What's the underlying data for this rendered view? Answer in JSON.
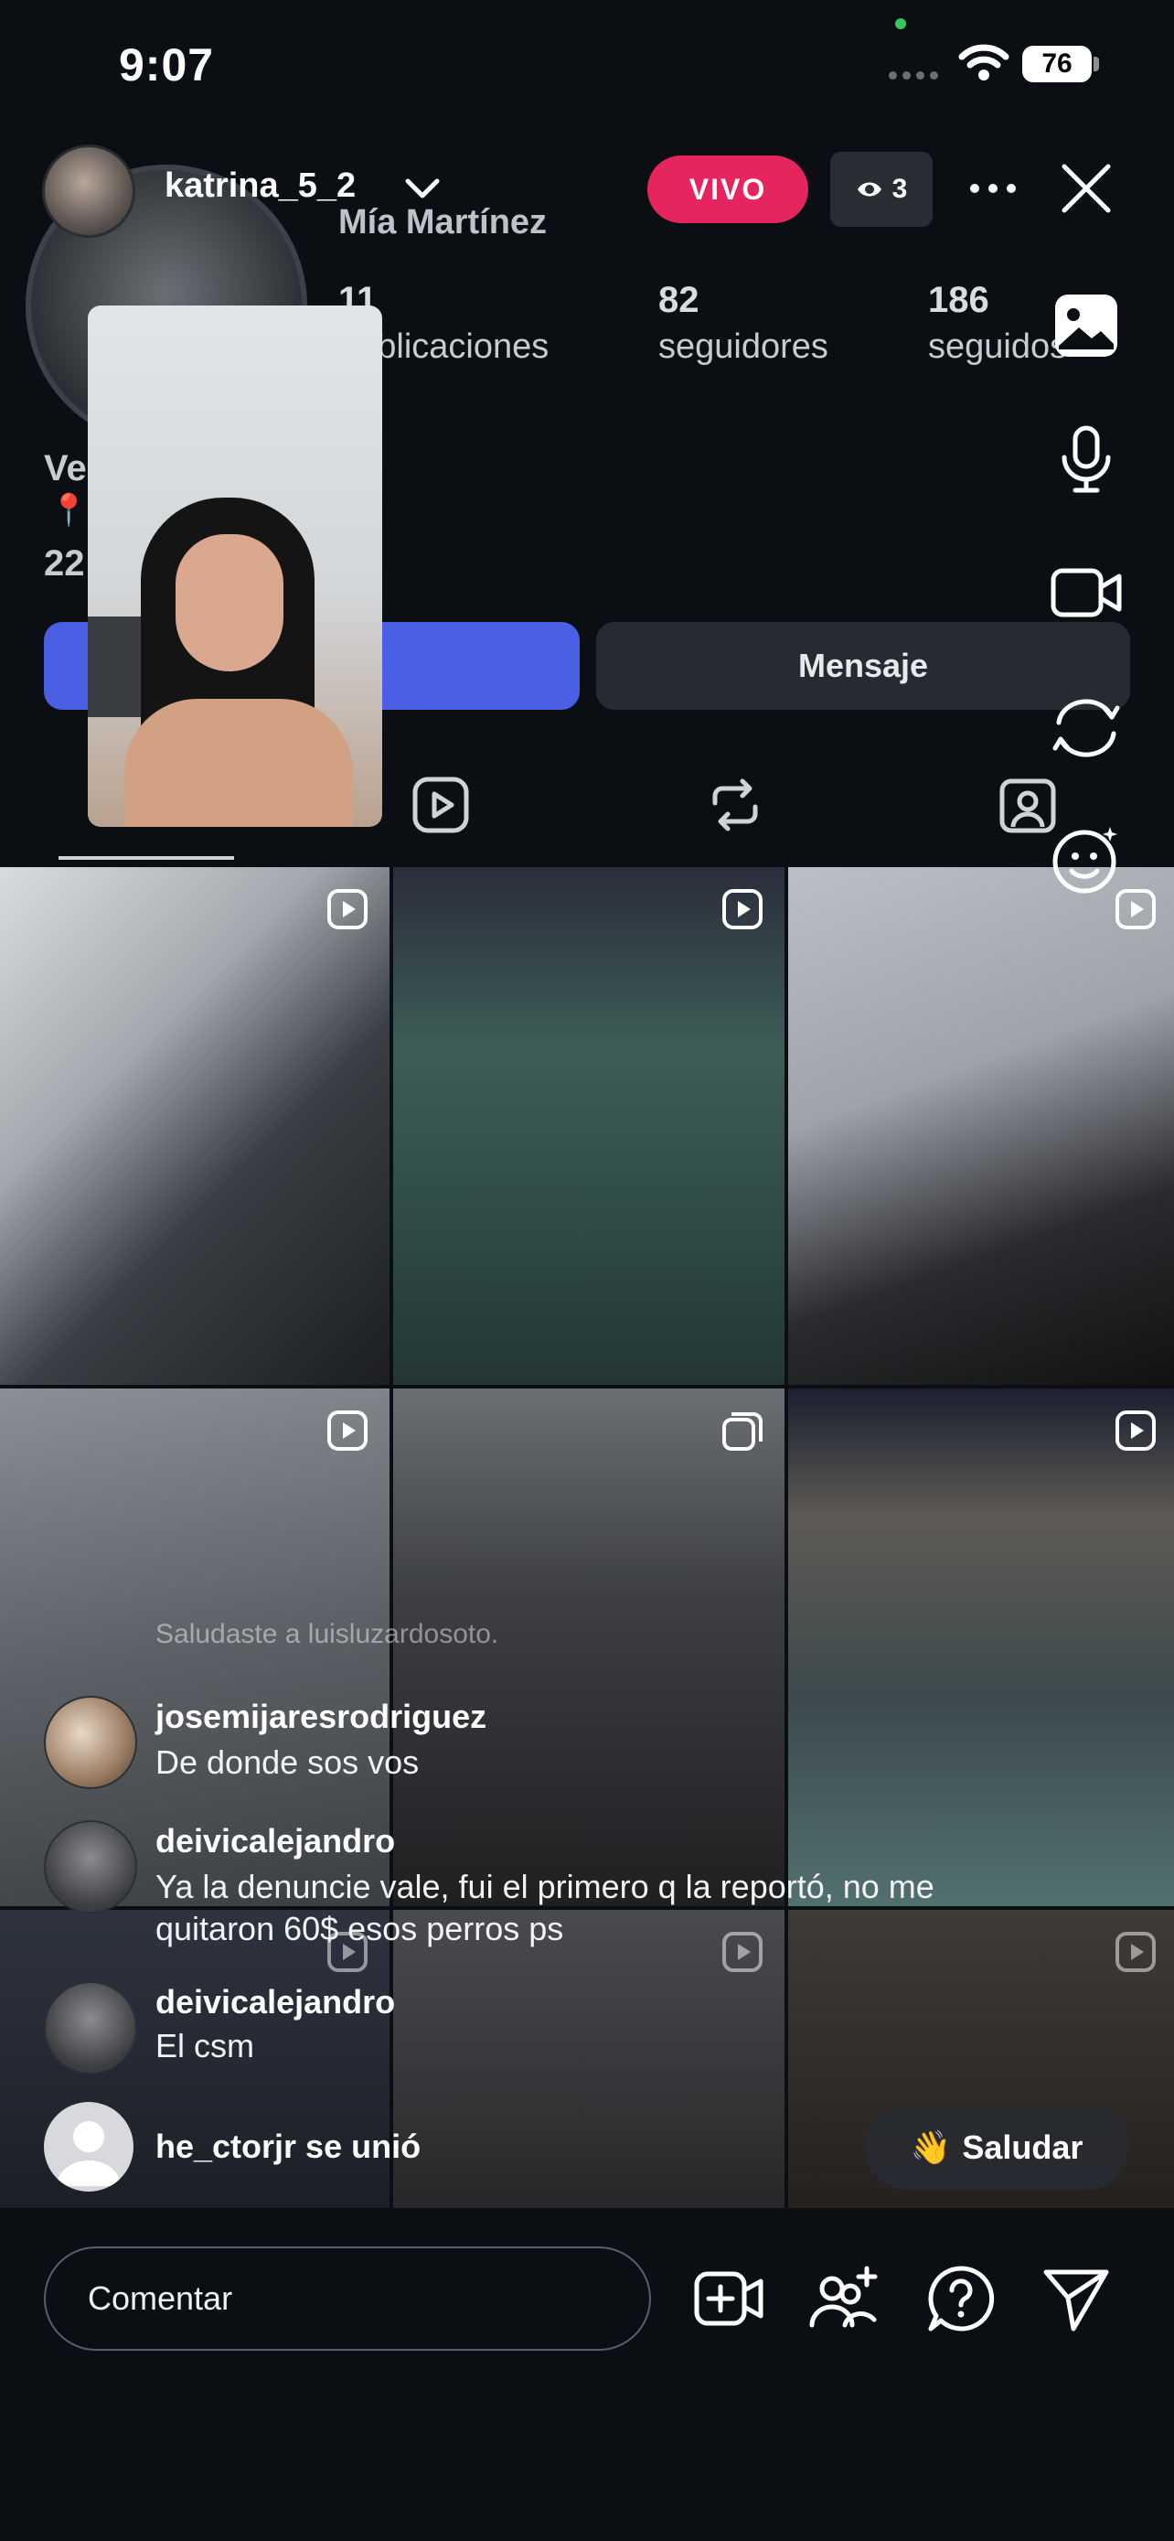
{
  "status_bar": {
    "time": "9:07",
    "battery": "76"
  },
  "header": {
    "username": "katrina_5_2",
    "live_label": "VIVO",
    "viewer_count": "3"
  },
  "profile_background": {
    "display_name": "Mía Martínez",
    "stats": [
      {
        "value": "11",
        "label": "publicaciones"
      },
      {
        "value": "82",
        "label": "seguidores"
      },
      {
        "value": "186",
        "label": "seguidos"
      }
    ],
    "side_texts": [
      "Ve",
      "📍",
      "22"
    ],
    "message_button": "Mensaje"
  },
  "notice": "Saludaste a luisluzardosoto.",
  "comments": [
    {
      "user": "josemijaresrodriguez",
      "text": "De donde sos vos"
    },
    {
      "user": "deivicalejandro",
      "text": "Ya la denuncie vale, fui el primero q la reportó, no me quitaron 60$ esos perros ps"
    },
    {
      "user": "deivicalejandro",
      "text": "El csm"
    }
  ],
  "join_event": {
    "text": "he_ctorjr se unió"
  },
  "wave_button": {
    "emoji": "👋",
    "label": "Saludar"
  },
  "composer": {
    "placeholder": "Comentar"
  },
  "icons": {
    "top": [
      "chevron-down-icon",
      "eye-icon",
      "more-icon",
      "close-icon"
    ],
    "side_tools": [
      "gallery-icon",
      "microphone-icon",
      "video-camera-icon",
      "flip-camera-icon",
      "effects-icon"
    ],
    "bottom": [
      "add-video-icon",
      "add-guest-icon",
      "question-icon",
      "send-icon"
    ]
  },
  "colors": {
    "live": "#e6245e",
    "follow": "#4b5fe6",
    "background": "#0b0f14"
  }
}
